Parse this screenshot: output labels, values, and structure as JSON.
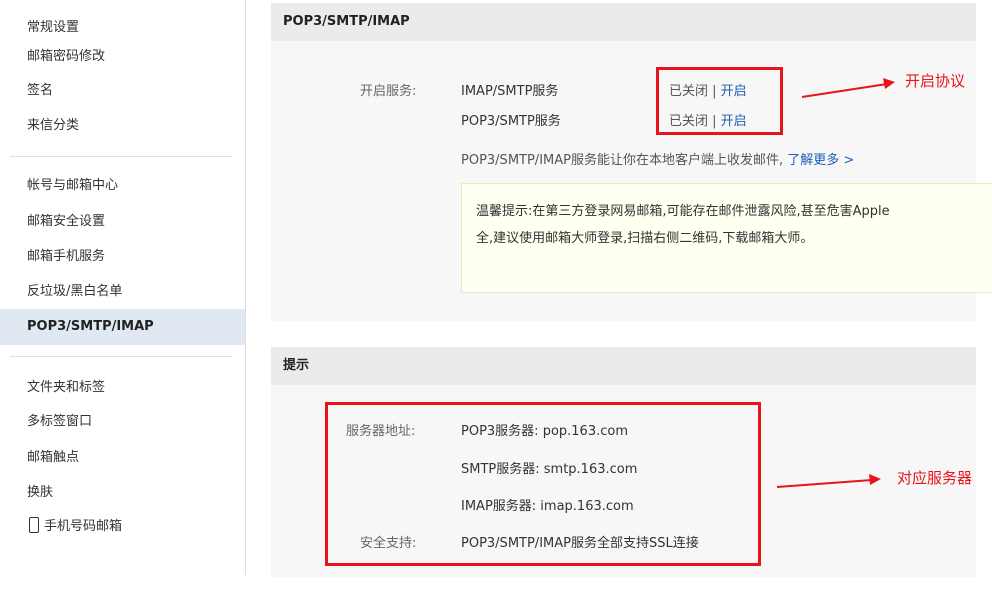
{
  "sidebar": {
    "group1": [
      "常规设置",
      "邮箱密码修改",
      "签名",
      "来信分类"
    ],
    "group2": [
      "帐号与邮箱中心",
      "邮箱安全设置",
      "邮箱手机服务",
      "反垃圾/黑白名单",
      "POP3/SMTP/IMAP"
    ],
    "group3": [
      "文件夹和标签",
      "多标签窗口",
      "邮箱触点",
      "换肤",
      "手机号码邮箱"
    ]
  },
  "pop_panel": {
    "title": "POP3/SMTP/IMAP",
    "enable_label": "开启服务:",
    "services": [
      {
        "name": "IMAP/SMTP服务",
        "status": "已关闭",
        "sep": " | ",
        "action": "开启"
      },
      {
        "name": "POP3/SMTP服务",
        "status": "已关闭",
        "sep": " | ",
        "action": "开启"
      }
    ],
    "desc": "POP3/SMTP/IMAP服务能让你在本地客户端上收发邮件,",
    "learn_more": "了解更多 >",
    "tip_line1": "温馨提示:在第三方登录网易邮箱,可能存在邮件泄露风险,甚至危害Apple",
    "tip_line2": "全,建议使用邮箱大师登录,扫描右侧二维码,下载邮箱大师。"
  },
  "hint_panel": {
    "title": "提示",
    "server_label": "服务器地址:",
    "servers": [
      "POP3服务器: pop.163.com",
      "SMTP服务器: smtp.163.com",
      "IMAP服务器: imap.163.com"
    ],
    "security_label": "安全支持:",
    "security_value": "POP3/SMTP/IMAP服务全部支持SSL连接"
  },
  "annotations": {
    "top": "开启协议",
    "bottom": "对应服务器",
    "color": "#e8141b"
  }
}
